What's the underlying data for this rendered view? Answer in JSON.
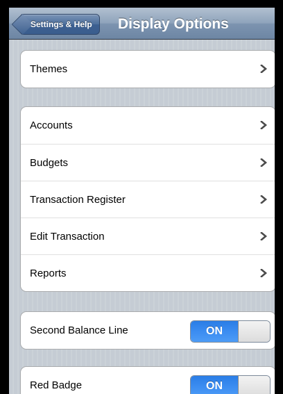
{
  "nav": {
    "back_label": "Settings & Help",
    "title": "Display Options"
  },
  "sections": [
    {
      "items": [
        {
          "label": "Themes",
          "type": "disclosure"
        }
      ]
    },
    {
      "items": [
        {
          "label": "Accounts",
          "type": "disclosure"
        },
        {
          "label": "Budgets",
          "type": "disclosure"
        },
        {
          "label": "Transaction Register",
          "type": "disclosure"
        },
        {
          "label": "Edit Transaction",
          "type": "disclosure"
        },
        {
          "label": "Reports",
          "type": "disclosure"
        }
      ]
    },
    {
      "items": [
        {
          "label": "Second Balance Line",
          "type": "toggle",
          "value": "ON"
        }
      ]
    },
    {
      "items": [
        {
          "label": "Red Badge",
          "type": "toggle",
          "value": "ON"
        }
      ]
    }
  ],
  "icons": {
    "disclosure": "chevron-right-icon",
    "back": "back-arrow-icon"
  },
  "colors": {
    "toggle_on": "#3b8cf1",
    "navbar": "#8ea3bb",
    "background": "#c5ccd4"
  }
}
